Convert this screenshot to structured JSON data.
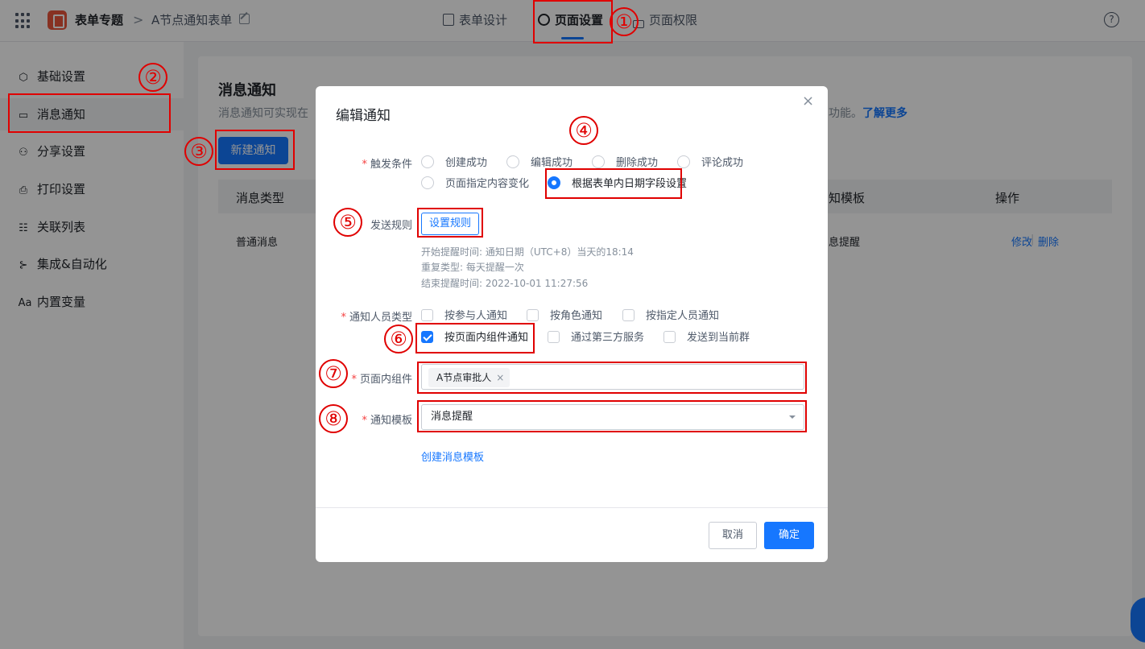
{
  "topbar": {
    "app_name": "表单专题",
    "separator": ">",
    "form_name": "A节点通知表单",
    "tabs": [
      {
        "label": "表单设计",
        "icon": "document-icon"
      },
      {
        "label": "页面设置",
        "icon": "gear-icon",
        "active": true
      },
      {
        "label": "页面权限",
        "icon": "lock-icon"
      }
    ],
    "help": "?"
  },
  "sidebar": {
    "items": [
      {
        "label": "基础设置",
        "icon": "cube-icon"
      },
      {
        "label": "消息通知",
        "icon": "message-icon",
        "active": true
      },
      {
        "label": "分享设置",
        "icon": "share-icon"
      },
      {
        "label": "打印设置",
        "icon": "printer-icon"
      },
      {
        "label": "关联列表",
        "icon": "list-icon"
      },
      {
        "label": "集成&自动化",
        "icon": "integration-icon"
      },
      {
        "label": "内置变量",
        "icon": "text-variable-icon",
        "icon_text": "Aa"
      }
    ]
  },
  "content": {
    "title": "消息通知",
    "description": "消息通知可实现在",
    "description_tail": "功能。",
    "learn_more": "了解更多",
    "new_button": "新建通知",
    "table": {
      "headers": [
        "消息类型",
        "知模板",
        "操作"
      ],
      "row": {
        "type": "普通消息",
        "template": "息提醒",
        "edit": "修改",
        "delete": "删除"
      }
    }
  },
  "modal": {
    "title": "编辑通知",
    "close": "×",
    "trigger": {
      "label": "触发条件",
      "options": [
        "创建成功",
        "编辑成功",
        "删除成功",
        "评论成功",
        "页面指定内容变化",
        "根据表单内日期字段设置"
      ],
      "selected": "根据表单内日期字段设置"
    },
    "send_rule": {
      "label": "发送规则",
      "button": "设置规则",
      "info": [
        "开始提醒时间: 通知日期（UTC+8）当天的18:14",
        "重复类型: 每天提醒一次",
        "结束提醒时间: 2022-10-01 11:27:56"
      ]
    },
    "recipient_type": {
      "label": "通知人员类型",
      "options": [
        "按参与人通知",
        "按角色通知",
        "按指定人员通知",
        "按页面内组件通知",
        "通过第三方服务",
        "发送到当前群"
      ],
      "checked": "按页面内组件通知"
    },
    "page_component": {
      "label": "页面内组件",
      "tag": "A节点审批人",
      "tag_close": "×"
    },
    "template": {
      "label": "通知模板",
      "value": "消息提醒"
    },
    "create_template": "创建消息模板",
    "cancel": "取消",
    "ok": "确定"
  },
  "annotations": [
    "①",
    "②",
    "③",
    "④",
    "⑤",
    "⑥",
    "⑦",
    "⑧"
  ],
  "colors": {
    "primary": "#1677ff",
    "annotation": "#e00000",
    "required": "#f53f3f"
  }
}
